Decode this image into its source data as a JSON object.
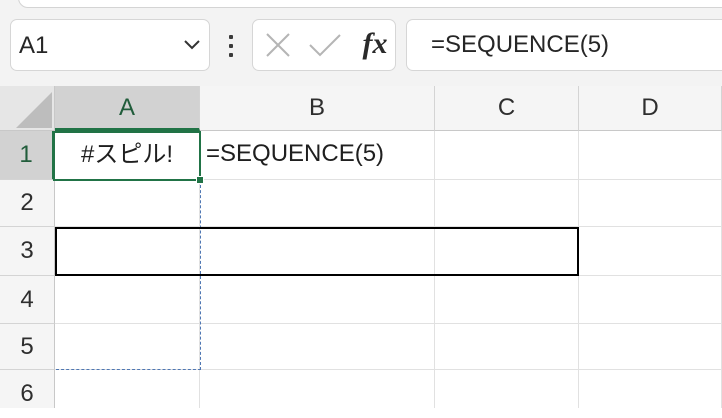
{
  "formula_bar": {
    "name_box": "A1",
    "cancel_icon": "x-icon",
    "enter_icon": "checkmark-icon",
    "fx_label": "fx",
    "formula": "=SEQUENCE(5)"
  },
  "columns": [
    "A",
    "B",
    "C",
    "D"
  ],
  "rows": [
    "1",
    "2",
    "3",
    "4",
    "5",
    "6"
  ],
  "cells": {
    "A1": "#スピル!",
    "B1": "=SEQUENCE(5)"
  },
  "colors": {
    "selection_green": "#217346",
    "spill_dashed_blue": "#4f77b3",
    "blocking_border": "#000000"
  }
}
